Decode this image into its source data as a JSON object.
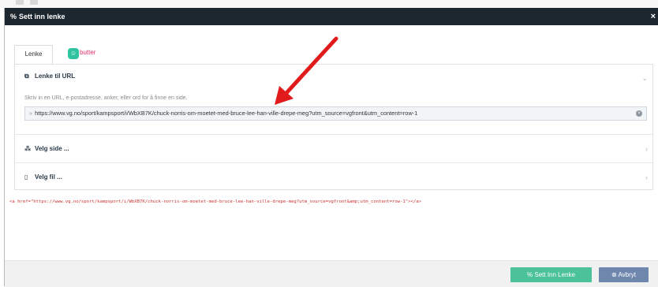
{
  "dialog": {
    "title": "Sett inn lenke",
    "title_icon": "link-icon",
    "close_glyph": "×"
  },
  "tabs": [
    {
      "label": "Lenke",
      "active": true
    },
    {
      "label": "butter",
      "icon": "robot-badge-icon"
    }
  ],
  "url_section": {
    "heading": "Lenke til URL",
    "hint": "Skriv in en URL, e-postadresse, anker, eller ord for å finne en side.",
    "url_value": "https://www.vg.no/sport/kampsport/i/WbXB7K/chuck-norris-om-moetet-med-bruce-lee-han-ville-drepe-meg?utm_source=vgfront&utm_content=row-1"
  },
  "sections": [
    {
      "heading": "Velg side ...",
      "icon": "sitemap-icon"
    },
    {
      "heading": "Velg fil ...",
      "icon": "file-icon"
    }
  ],
  "html_preview": "<a href=\"https://www.vg.no/sport/kampsport/i/WbXB7K/chuck-norris-om-moetet-med-bruce-lee-han-ville-drepe-meg?utm_source=vgfront&amp;utm_content=row-1\"></a>",
  "footer": {
    "insert_label": "Sett Inn Lenke",
    "cancel_label": "Avbryt"
  },
  "colors": {
    "titlebar": "#1d2730",
    "insert_button": "#4cc29a",
    "cancel_button": "#6f87ad",
    "annotation_arrow": "#e11b1b",
    "code_text": "#cc3333"
  }
}
